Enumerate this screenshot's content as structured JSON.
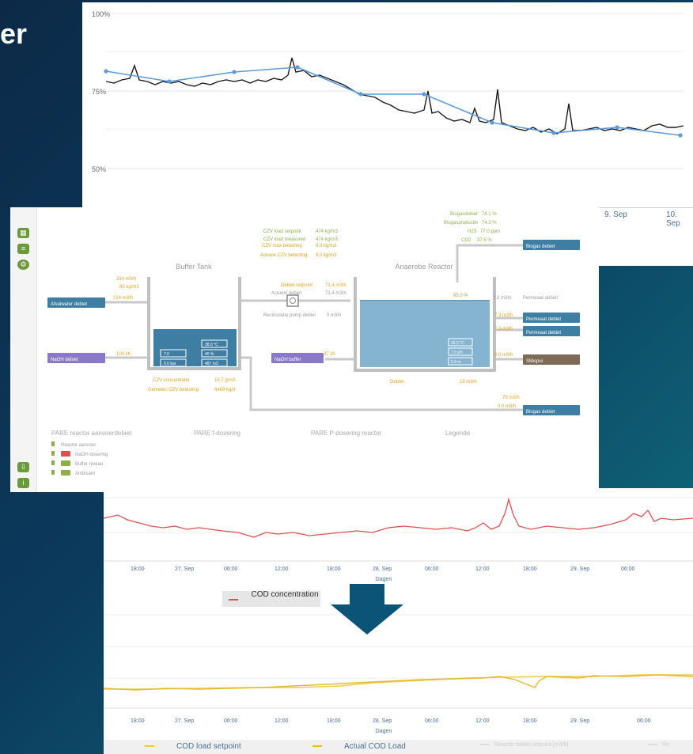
{
  "slide": {
    "title_fragment": "er"
  },
  "colors": {
    "background_start": "#0c2a48",
    "background_end": "#178a86",
    "series_black": "#1a1a1a",
    "series_blue": "#5b9bdb",
    "series_red": "#e05050",
    "series_yellow": "#e7b92c",
    "orange_text": "#e4a21b",
    "green_text": "#8bb04a",
    "blue_box": "#3f7ea3",
    "purple_box": "#8a78c8",
    "brown_box": "#7e6b57",
    "arrow": "#0b5377"
  },
  "top_chart": {
    "y_ticks": [
      "100%",
      "75%",
      "50%"
    ],
    "x_ticks": [
      "9. Sep",
      "10. Sep"
    ]
  },
  "process": {
    "labels": {
      "buffer_tank": "Buffer Tank",
      "anaerobe_reactor": "Anaerobe Reactor"
    },
    "boxes": {
      "afvalwater_debiet": "Afvalwater debiet",
      "naoh_debiet": "NaOH debiet",
      "naoh_buffer": "NaOH buffer",
      "biogas_debiet": "Biogas debiet",
      "permeaat_debiet_1": "Permeaat debiet",
      "permeaat_debiet_2": "Permeaat debiet",
      "slibspui": "Slibspui",
      "biogas_debiet_2": "Biogas debiet"
    },
    "inline_values": {
      "afval_1": "214 m3/h",
      "afval_2": "80 kg/m3",
      "afval_3": "214 m3/h",
      "naoh_val": "100 l/h",
      "naoh_buffer_val": "37 l/h",
      "tank_a": "38.0 °C",
      "tank_b": "7.0",
      "tank_c": "40 %",
      "tank_d": "0.0 bar",
      "tank_e": "487 m3",
      "reactor_a": "36.5 °C",
      "reactor_b": "7.0 pH",
      "reactor_c": "6.8 m",
      "reactor_top": "95.0 %",
      "biogas_val": "7.3 m3/h",
      "perm_1": "7.3 m3/h",
      "perm_2": "7.3 m3/h",
      "slib_val": "0.0 m3/h",
      "biogas_val_2": "78 m3/h",
      "biogas_val_3": "0.0 m3/h",
      "czv_conc": "CZV concentratie",
      "czv_conc_val": "15.7 g/m3",
      "czv_load": "Gemeten CZV belasting",
      "czv_load_val": "4469 kg/d",
      "debiet_setpoint": "Debiet setpoint",
      "debiet_setpoint_val": "71.4 m3/h",
      "actual_debiet": "Actueel debiet",
      "actual_debiet_val": "71.4 m3/h",
      "recirc": "Recirculatie pomp debiet",
      "recirc_val": "0 m3/h",
      "gas_l1": "CZV load setpoint",
      "gas_l1_v": "474 kg/m3",
      "gas_l2": "CZV load measured",
      "gas_l2_v": "474 kg/m3",
      "gas_l3": "CZV max belasting",
      "gas_l3_v": "8.0 kg/m3",
      "gas_l4": "Actuele CZV belasting",
      "gas_l4_v": "8.0 kg/m3",
      "r_l1": "Biogasdebiet",
      "r_l1_v": "74.1 %",
      "r_l2": "Biogasproductie",
      "r_l2_v": "74.3 %",
      "r_l3": "H2S",
      "r_l3_v": "77.0 ppm",
      "r_l4": "CO2",
      "r_l4_v": "37.5 %",
      "perm_total": "Permeaat debiet",
      "perm_total_val": "7.3 m3/h",
      "debiet_out": "Debiet",
      "debiet_out_val": "18 m3/h"
    },
    "sections": [
      "PARE reactor aanvoerdebiet",
      "PARE f-dosering",
      "PARE P-dosering reactor",
      "Legende"
    ],
    "toggles": [
      "Reactor aanvoer",
      "NaOH dosering",
      "Buffer niveau",
      "Ambisant"
    ]
  },
  "cod_chart": {
    "x_ticks": [
      "18:00",
      "27. Sep",
      "06:00",
      "12:00",
      "18:00",
      "28. Sep",
      "06:00",
      "12:00",
      "18:00",
      "29. Sep",
      "06:00"
    ],
    "x_label": "Dagen",
    "legend": "COD concentration"
  },
  "load_chart": {
    "x_ticks": [
      "18:00",
      "27. Sep",
      "06:00",
      "12:00",
      "18:00",
      "28. Sep",
      "06:00",
      "12:00",
      "18:00",
      "29. Sep",
      "06:00"
    ],
    "x_label": "Dagen",
    "legend": [
      "COD load setpoint",
      "Actual COD Load",
      "Reactor debiet setpoint [m3/h]",
      "Re"
    ]
  }
}
